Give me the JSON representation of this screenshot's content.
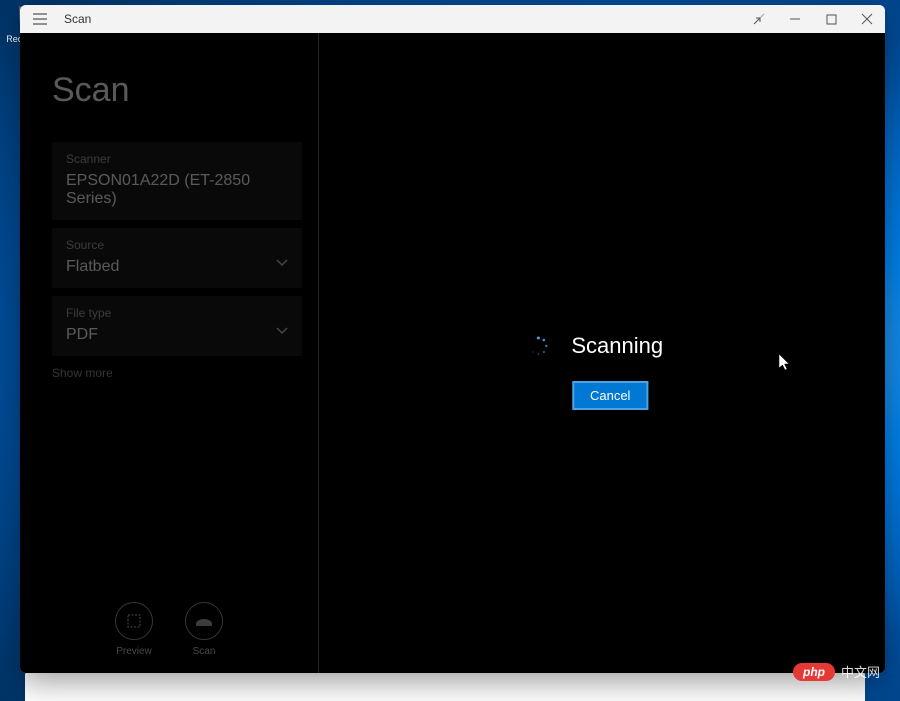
{
  "desktop": {
    "recycle_bin": "Recycle Bin"
  },
  "titlebar": {
    "title": "Scan"
  },
  "sidebar": {
    "page_title": "Scan",
    "scanner": {
      "label": "Scanner",
      "value": "EPSON01A22D (ET-2850 Series)"
    },
    "source": {
      "label": "Source",
      "value": "Flatbed"
    },
    "filetype": {
      "label": "File type",
      "value": "PDF"
    },
    "show_more": "Show more",
    "footer": {
      "preview": "Preview",
      "scan": "Scan"
    }
  },
  "progress": {
    "status_text": "Scanning",
    "cancel_label": "Cancel"
  },
  "watermark": {
    "badge": "php",
    "text": "中文网"
  }
}
